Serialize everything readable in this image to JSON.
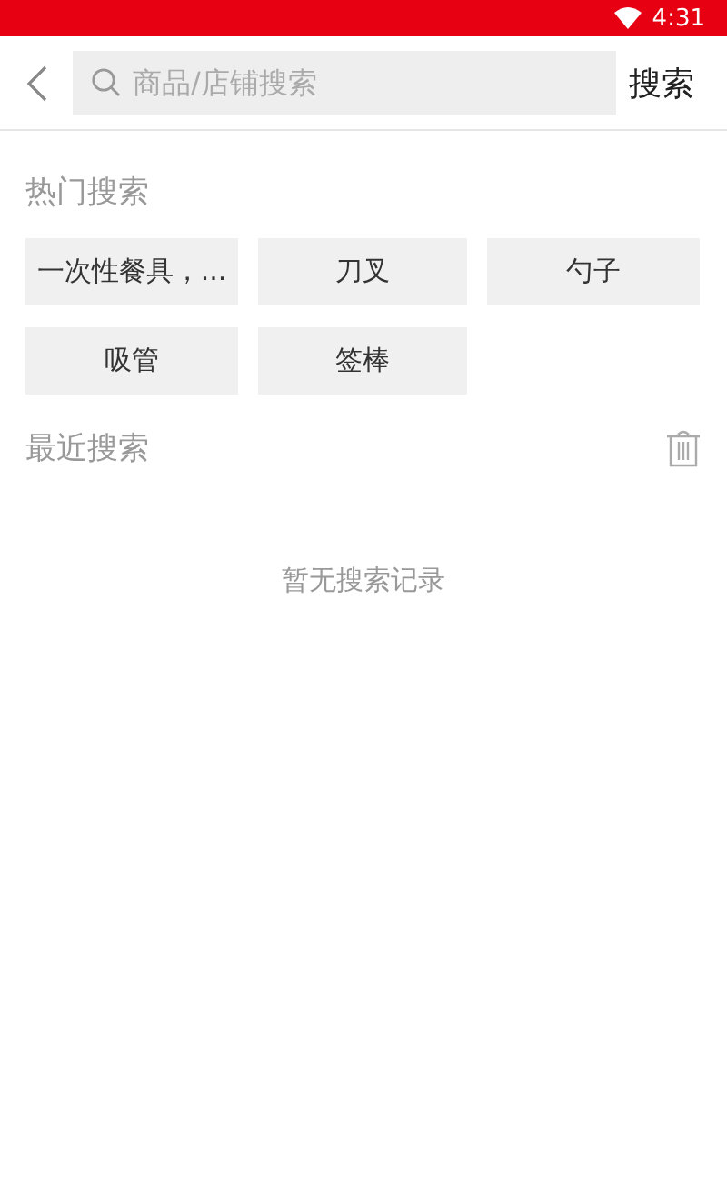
{
  "status_bar": {
    "time": "4:31"
  },
  "header": {
    "search": {
      "placeholder": "商品/店铺搜索"
    },
    "search_button": "搜索"
  },
  "hot_searches": {
    "title": "热门搜索",
    "tags": [
      {
        "label": "一次性餐具，..."
      },
      {
        "label": "刀叉"
      },
      {
        "label": "勺子"
      },
      {
        "label": "吸管"
      },
      {
        "label": "签棒"
      }
    ]
  },
  "recent_searches": {
    "title": "最近搜索",
    "empty_text": "暂无搜索记录"
  }
}
